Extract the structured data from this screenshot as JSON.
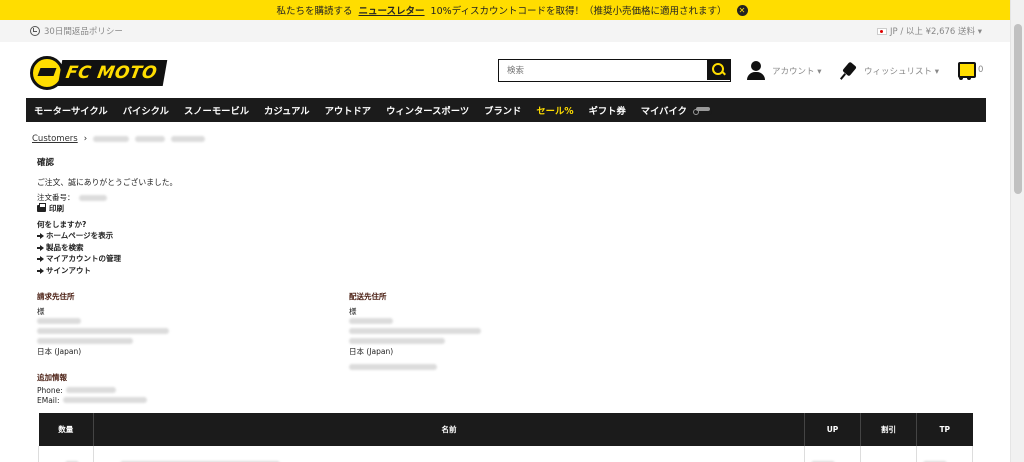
{
  "promo": {
    "prefix": "私たちを購読する",
    "highlight": "ニュースレター",
    "suffix": "10%ディスカウントコードを取得！（推奨小売価格に適用されます）",
    "close_icon": "close-icon"
  },
  "utility": {
    "return_policy": "30日間返品ポリシー",
    "locale": "JP / 以上 ¥2,676 送料 ▾"
  },
  "header": {
    "logo_text": "FC MOTO",
    "search_placeholder": "検索",
    "account_label": "アカウント ▾",
    "wishlist_label": "ウィッシュリスト ▾",
    "cart_count": "0"
  },
  "nav": {
    "items": [
      "モーターサイクル",
      "バイシクル",
      "スノーモービル",
      "カジュアル",
      "アウトドア",
      "ウィンタースポーツ",
      "ブランド",
      "セール%",
      "ギフト券",
      "マイバイク"
    ]
  },
  "breadcrumb": {
    "root": "Customers",
    "sep": "›"
  },
  "confirmation": {
    "title": "確認",
    "thanks": "ご注文、誠にありがとうございました。",
    "order_label": "注文番号：",
    "print_label": "印刷",
    "next_title": "何をしますか?",
    "links": [
      "ホームページを表示",
      "製品を検索",
      "マイアカウントの管理",
      "サインアウト"
    ]
  },
  "billing": {
    "heading": "請求先住所",
    "salutation": "様",
    "country": "日本 (Japan)"
  },
  "shipping": {
    "heading": "配送先住所",
    "salutation": "様",
    "country": "日本 (Japan)"
  },
  "extra_info": {
    "heading": "追加情報",
    "phone_label": "Phone:",
    "email_label": "EMail:"
  },
  "order_table": {
    "headers": [
      "数量",
      "名前",
      "UP",
      "割引",
      "TP"
    ]
  },
  "colors": {
    "brand_yellow": "#ffdd00",
    "nav_bg": "#1b1b1b",
    "heading_brown": "#4a1e12"
  }
}
